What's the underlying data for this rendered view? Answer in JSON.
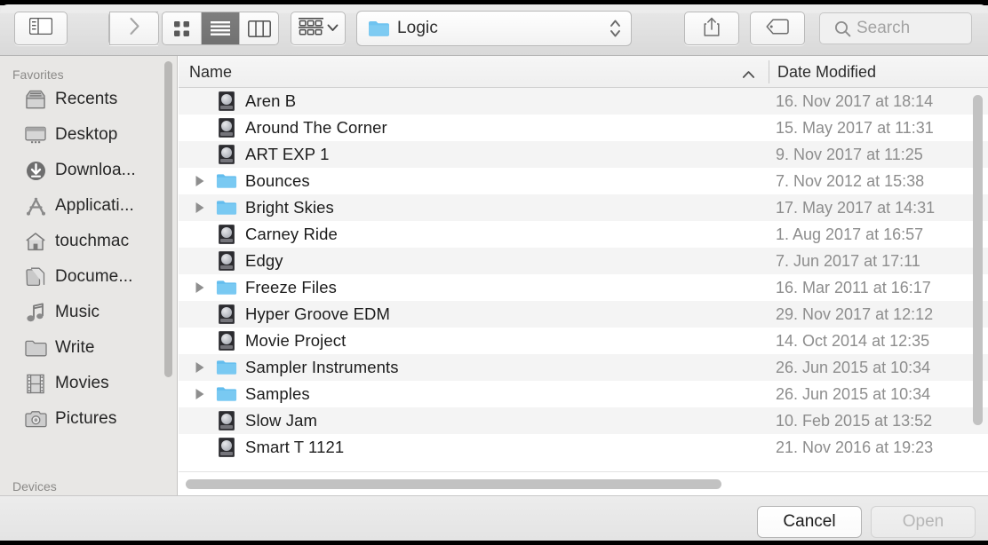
{
  "toolbar": {
    "sidebar_toggle": "sidebar-toggle",
    "back": "back",
    "forward": "forward",
    "view_icon": "icon-view",
    "view_list": "list-view",
    "view_column": "column-view",
    "arrange": "arrange-by",
    "path_label": "Logic",
    "share": "share",
    "tag": "tags",
    "search_placeholder": "Search",
    "search_value": ""
  },
  "sidebar": {
    "sections": [
      {
        "title": "Favorites",
        "items": [
          {
            "label": "Recents",
            "icon": "recents-icon"
          },
          {
            "label": "Desktop",
            "icon": "desktop-icon"
          },
          {
            "label": "Downloa...",
            "icon": "downloads-icon"
          },
          {
            "label": "Applicati...",
            "icon": "applications-icon"
          },
          {
            "label": "touchmac",
            "icon": "home-icon"
          },
          {
            "label": "Docume...",
            "icon": "documents-icon"
          },
          {
            "label": "Music",
            "icon": "music-icon"
          },
          {
            "label": "Write",
            "icon": "folder-icon"
          },
          {
            "label": "Movies",
            "icon": "movies-icon"
          },
          {
            "label": "Pictures",
            "icon": "pictures-icon"
          }
        ]
      },
      {
        "title": "Devices",
        "items": []
      }
    ]
  },
  "filelist": {
    "columns": {
      "name": "Name",
      "date_modified": "Date Modified",
      "sort_direction": "ascending"
    },
    "rows": [
      {
        "name": "Aren B",
        "date": "16. Nov 2017 at 18:14",
        "kind": "logic-project",
        "expandable": false
      },
      {
        "name": "Around The Corner",
        "date": "15. May 2017 at 11:31",
        "kind": "logic-project",
        "expandable": false
      },
      {
        "name": "ART EXP 1",
        "date": "9. Nov 2017 at 11:25",
        "kind": "logic-project",
        "expandable": false
      },
      {
        "name": "Bounces",
        "date": "7. Nov 2012 at 15:38",
        "kind": "folder",
        "expandable": true
      },
      {
        "name": "Bright Skies",
        "date": "17. May 2017 at 14:31",
        "kind": "folder",
        "expandable": true
      },
      {
        "name": "Carney Ride",
        "date": "1. Aug 2017 at 16:57",
        "kind": "logic-project",
        "expandable": false
      },
      {
        "name": "Edgy",
        "date": "7. Jun 2017 at 17:11",
        "kind": "logic-project",
        "expandable": false
      },
      {
        "name": "Freeze Files",
        "date": "16. Mar 2011 at 16:17",
        "kind": "folder",
        "expandable": true
      },
      {
        "name": "Hyper Groove EDM",
        "date": "29. Nov 2017 at 12:12",
        "kind": "logic-project",
        "expandable": false
      },
      {
        "name": "Movie Project",
        "date": "14. Oct 2014 at 12:35",
        "kind": "logic-project",
        "expandable": false
      },
      {
        "name": "Sampler Instruments",
        "date": "26. Jun 2015 at 10:34",
        "kind": "folder",
        "expandable": true
      },
      {
        "name": "Samples",
        "date": "26. Jun 2015 at 10:34",
        "kind": "folder",
        "expandable": true
      },
      {
        "name": "Slow Jam",
        "date": "10. Feb 2015 at 13:52",
        "kind": "logic-project",
        "expandable": false
      },
      {
        "name": "Smart T 1121",
        "date": "21. Nov 2016 at 19:23",
        "kind": "logic-project",
        "expandable": false
      }
    ]
  },
  "footer": {
    "cancel_label": "Cancel",
    "open_label": "Open",
    "open_enabled": false
  },
  "colors": {
    "folder_blue": "#6fc3f0",
    "selected_segment": "#777777",
    "row_alt": "#f4f4f4",
    "scrollbar": "#c2c2c2"
  }
}
